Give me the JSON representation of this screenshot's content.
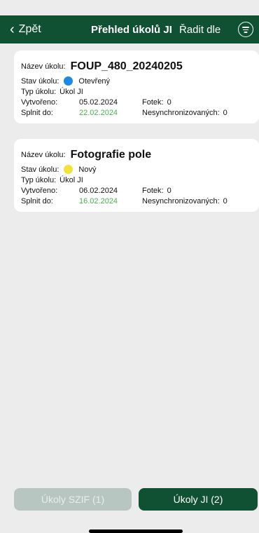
{
  "nav": {
    "back_label": "Zpět",
    "title": "Přehled úkolů JI",
    "sort_label": "Řadit dle"
  },
  "labels": {
    "name": "Název úkolu:",
    "state": "Stav úkolu:",
    "type": "Typ úkolu:",
    "created": "Vytvořeno:",
    "due": "Splnit do:",
    "photos": "Fotek:",
    "unsynced": "Nesynchronizovaných:"
  },
  "tasks": [
    {
      "name": "FOUP_480_20240205",
      "state": "Otevřený",
      "state_color": "#1e88e5",
      "type": "Úkol JI",
      "created": "05.02.2024",
      "due": "22.02.2024",
      "photos": "0",
      "unsynced": "0"
    },
    {
      "name": "Fotografie pole",
      "state": "Nový",
      "state_color": "#f2e33b",
      "type": "Úkol JI",
      "created": "06.02.2024",
      "due": "16.02.2024",
      "photos": "0",
      "unsynced": "0"
    }
  ],
  "bottom": {
    "szif_label": "Úkoly SZIF (1)",
    "ji_label": "Úkoly JI (2)"
  }
}
